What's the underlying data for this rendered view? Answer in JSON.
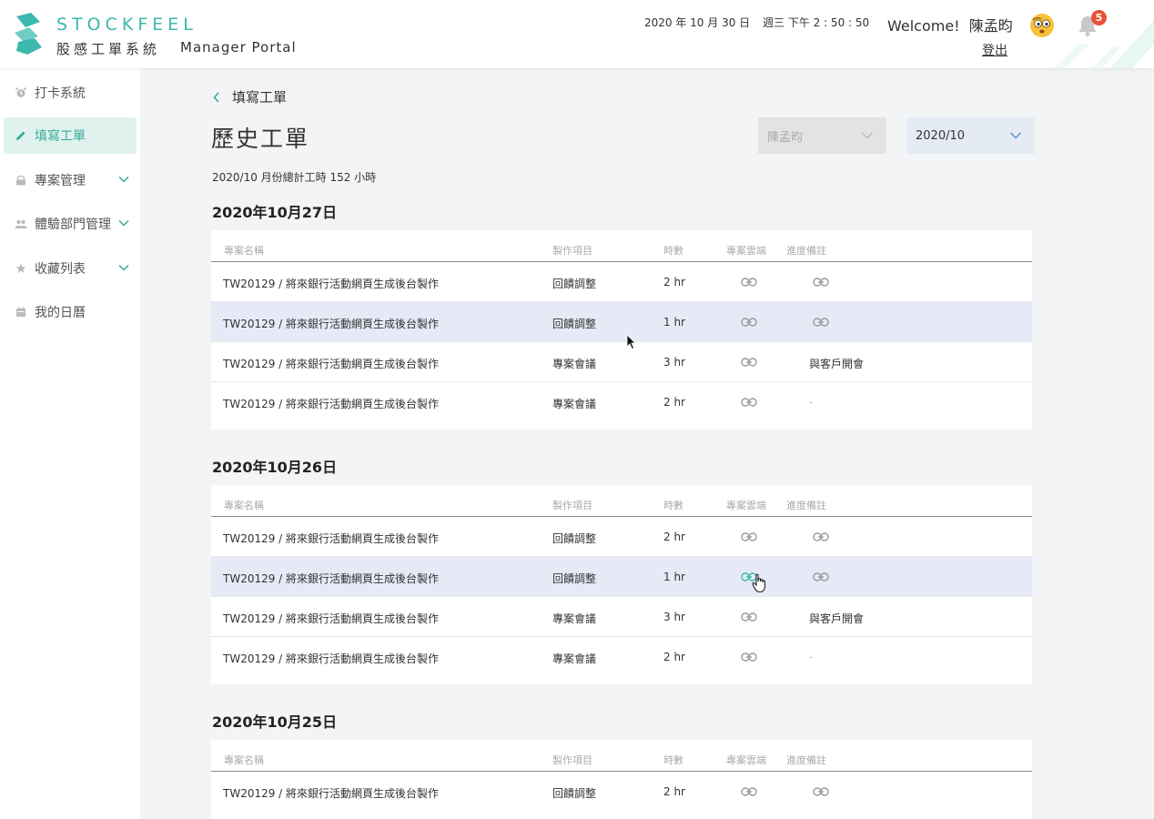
{
  "header": {
    "brand_en": "STOCKFEEL",
    "brand_zh": "股感工單系統",
    "portal": "Manager Portal",
    "date": "2020 年 10 月 30 日",
    "time": "週三 下午 2 : 50 : 50",
    "welcome": "Welcome!  陳孟昀",
    "logout": "登出",
    "notification_count": "5",
    "accent_color": "#3cb8ad"
  },
  "sidebar": {
    "items": [
      {
        "label": "打卡系統",
        "icon": "alarm-icon"
      },
      {
        "label": "填寫工單",
        "icon": "pencil-icon",
        "active": true
      },
      {
        "label": "專案管理",
        "icon": "lock-icon"
      },
      {
        "label": "體驗部門管理",
        "icon": "people-icon"
      },
      {
        "label": "收藏列表",
        "icon": "star-icon"
      },
      {
        "label": "我的日曆",
        "icon": "calendar-icon"
      }
    ]
  },
  "main": {
    "breadcrumb": "填寫工單",
    "title": "歷史工單",
    "user_select": "陳孟昀",
    "month_select": "2020/10",
    "summary": "2020/10 月份總計工時 152 小時",
    "columns": [
      "專案名稱",
      "製作項目",
      "時數",
      "專案雲端",
      "進度備註"
    ],
    "days": [
      {
        "date": "2020年10月27日",
        "rows": [
          {
            "name": "TW20129 / 將來銀行活動網頁生成後台製作",
            "item": "回饋調整",
            "hours": "2 hr",
            "note": ""
          },
          {
            "name": "TW20129 / 將來銀行活動網頁生成後台製作",
            "item": "回饋調整",
            "hours": "1 hr",
            "note": ""
          },
          {
            "name": "TW20129 / 將來銀行活動網頁生成後台製作",
            "item": "專案會議",
            "hours": "3 hr",
            "note": "與客戶開會"
          },
          {
            "name": "TW20129 / 將來銀行活動網頁生成後台製作",
            "item": "專案會議",
            "hours": "2 hr",
            "note": "-"
          }
        ]
      },
      {
        "date": "2020年10月26日",
        "rows": [
          {
            "name": "TW20129 / 將來銀行活動網頁生成後台製作",
            "item": "回饋調整",
            "hours": "2 hr",
            "note": ""
          },
          {
            "name": "TW20129 / 將來銀行活動網頁生成後台製作",
            "item": "回饋調整",
            "hours": "1 hr",
            "note": ""
          },
          {
            "name": "TW20129 / 將來銀行活動網頁生成後台製作",
            "item": "專案會議",
            "hours": "3 hr",
            "note": "與客戶開會"
          },
          {
            "name": "TW20129 / 將來銀行活動網頁生成後台製作",
            "item": "專案會議",
            "hours": "2 hr",
            "note": "-"
          }
        ]
      },
      {
        "date": "2020年10月25日",
        "rows": [
          {
            "name": "TW20129 / 將來銀行活動網頁生成後台製作",
            "item": "回饋調整",
            "hours": "2 hr",
            "note": ""
          }
        ]
      }
    ]
  }
}
